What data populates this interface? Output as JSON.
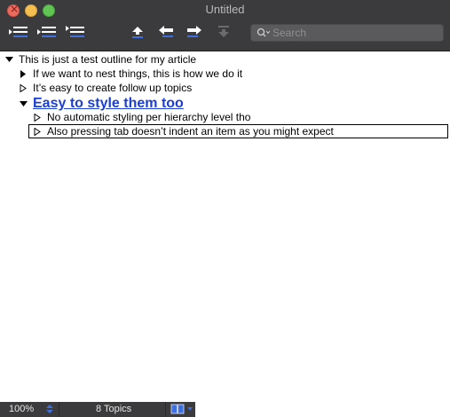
{
  "window": {
    "title": "Untitled"
  },
  "toolbar": {
    "buttons": [
      {
        "icon": "indent-left-icon"
      },
      {
        "icon": "indent-mid-icon"
      },
      {
        "icon": "indent-right-icon"
      },
      {
        "icon": "move-up-icon"
      },
      {
        "icon": "move-left-icon"
      },
      {
        "icon": "move-right-icon"
      },
      {
        "icon": "move-down-icon"
      }
    ],
    "search_placeholder": "Search"
  },
  "outline": {
    "items": [
      {
        "text": "This is just a test outline for my article",
        "level": 0,
        "expanded": true,
        "style": "normal"
      },
      {
        "text": "If we want to nest things, this is how we do it",
        "level": 1,
        "expanded": false,
        "style": "normal"
      },
      {
        "text": "It’s easy to create follow up topics",
        "level": 1,
        "expanded": false,
        "style": "normal"
      },
      {
        "text": "Easy to style them too",
        "level": 1,
        "expanded": true,
        "style": "heading"
      },
      {
        "text": "No automatic styling per hierarchy level tho",
        "level": 2,
        "expanded": false,
        "style": "normal"
      },
      {
        "text": "Also pressing tab doesn’t indent an item as you might expect",
        "level": 2,
        "expanded": false,
        "style": "normal",
        "editing": true
      }
    ]
  },
  "status": {
    "zoom": "100%",
    "topics": "8 Topics"
  },
  "colors": {
    "chrome": "#3b3b3d",
    "heading": "#1b3fd4",
    "icon_blue": "#3d6fe0"
  }
}
